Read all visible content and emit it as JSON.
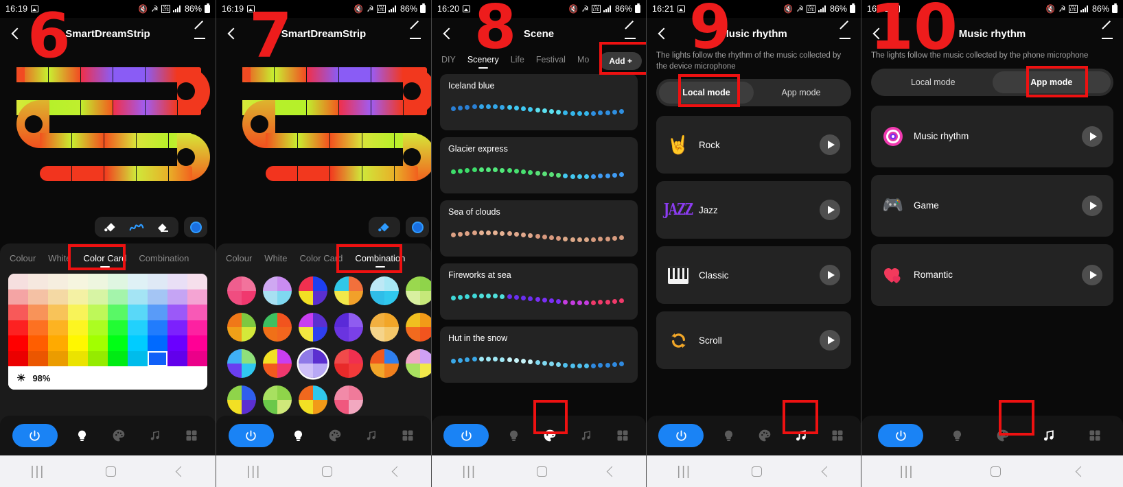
{
  "meta": {
    "app": "SmartDreamStrip LED controller",
    "accent": "#1a83f5",
    "annotation_color": "#ee1111"
  },
  "panels": [
    {
      "step": "6",
      "status": {
        "time": "16:19",
        "battery": "86%",
        "network": "LTE"
      },
      "header": {
        "title": "SmartDreamStrip",
        "back_icon": "chevron-left-icon",
        "edit_icon": "pencil-icon"
      },
      "tools": [
        "paint-bucket-icon",
        "brush-icon",
        "eraser-icon",
        "color-chip-icon"
      ],
      "tabs": [
        {
          "label": "Colour",
          "active": false
        },
        {
          "label": "White",
          "active": false
        },
        {
          "label": "Color Card",
          "active": true
        },
        {
          "label": "Combination",
          "active": false
        }
      ],
      "brightness": "98%",
      "brightness_icon": "sun-icon",
      "selected_swatch": "#1060f8",
      "nav": [
        "power-icon",
        "bulb-icon",
        "palette-icon",
        "music-icon",
        "grid-icon"
      ],
      "nav_active_index": 0,
      "highlight": "Color Card"
    },
    {
      "step": "7",
      "status": {
        "time": "16:19",
        "battery": "86%",
        "network": "LTE"
      },
      "header": {
        "title": "SmartDreamStrip",
        "back_icon": "chevron-left-icon",
        "edit_icon": "pencil-icon"
      },
      "tools": [
        "paint-bucket-icon",
        "color-chip-icon"
      ],
      "tabs": [
        {
          "label": "Colour",
          "active": false
        },
        {
          "label": "White",
          "active": false
        },
        {
          "label": "Color Card",
          "active": false
        },
        {
          "label": "Combination",
          "active": true
        }
      ],
      "nav": [
        "power-icon",
        "bulb-icon",
        "palette-icon",
        "music-icon",
        "grid-icon"
      ],
      "nav_active_index": 0,
      "highlight": "Combination"
    },
    {
      "step": "8",
      "status": {
        "time": "16:20",
        "battery": "86%",
        "network": "LTE"
      },
      "header": {
        "title": "Scene",
        "back_icon": "chevron-left-icon",
        "edit_icon": "pencil-icon"
      },
      "tabs": [
        {
          "label": "DIY",
          "active": false
        },
        {
          "label": "Scenery",
          "active": true
        },
        {
          "label": "Life",
          "active": false
        },
        {
          "label": "Festival",
          "active": false
        },
        {
          "label": "Mo",
          "active": false
        }
      ],
      "add_button": "Add +",
      "scenes": [
        {
          "name": "Iceland blue",
          "colors": [
            "#2a7fd4",
            "#33a6e8",
            "#40c8f2",
            "#5ce0f0",
            "#35b6ea",
            "#2f8fe0"
          ]
        },
        {
          "name": "Glacier express",
          "colors": [
            "#3ddd6a",
            "#52e87a",
            "#48e070",
            "#5ae078",
            "#43c8f0",
            "#3f9cf5"
          ]
        },
        {
          "name": "Sea of clouds",
          "colors": [
            "#dda184",
            "#e6b192",
            "#e0a88c",
            "#d8997e",
            "#dca888",
            "#d79b7e"
          ]
        },
        {
          "name": "Fireworks at sea",
          "colors": [
            "#3fd8d8",
            "#4fe0dc",
            "#6a2ff0",
            "#7a2ff5",
            "#c43ce0",
            "#f03a6a"
          ]
        },
        {
          "name": "Hut in the snow",
          "colors": [
            "#3aa8e8",
            "#9fe8f5",
            "#c6f2f8",
            "#7fd8f0",
            "#4fc0ee",
            "#2f8ae0"
          ]
        }
      ],
      "nav": [
        "power-icon",
        "bulb-icon",
        "palette-icon",
        "music-icon",
        "grid-icon"
      ],
      "nav_active_index": 0,
      "nav_highlight_index": 2,
      "highlight": "Add +"
    },
    {
      "step": "9",
      "status": {
        "time": "16:21",
        "battery": "86%",
        "network": "LTE"
      },
      "header": {
        "title": "Music rhythm",
        "back_icon": "chevron-left-icon",
        "edit_icon": "pencil-icon"
      },
      "subtitle": "The lights follow the rhythm of the music collected by the device microphone",
      "modes": [
        {
          "label": "Local mode",
          "active": true
        },
        {
          "label": "App mode",
          "active": false
        }
      ],
      "items": [
        {
          "label": "Rock",
          "icon": "rock-hand-icon",
          "play": "play-icon"
        },
        {
          "label": "Jazz",
          "icon": "jazz-text-icon",
          "play": "play-icon"
        },
        {
          "label": "Classic",
          "icon": "piano-icon",
          "play": "play-icon"
        },
        {
          "label": "Scroll",
          "icon": "scroll-loop-icon",
          "play": "play-icon"
        }
      ],
      "nav": [
        "power-icon",
        "bulb-icon",
        "palette-icon",
        "music-icon",
        "grid-icon"
      ],
      "nav_active_index": 0,
      "nav_highlight_index": 3,
      "highlight": "Local mode"
    },
    {
      "step": "10",
      "status": {
        "time": "16:21",
        "battery": "86%",
        "network": "LTE"
      },
      "header": {
        "title": "Music rhythm",
        "back_icon": "chevron-left-icon",
        "edit_icon": "pencil-icon"
      },
      "subtitle": "The lights follow the music collected by the phone microphone",
      "modes": [
        {
          "label": "Local mode",
          "active": false
        },
        {
          "label": "App mode",
          "active": true
        }
      ],
      "items": [
        {
          "label": "Music rhythm",
          "icon": "vinyl-disc-icon",
          "play": "play-icon"
        },
        {
          "label": "Game",
          "icon": "gamepad-icon",
          "play": "play-icon"
        },
        {
          "label": "Romantic",
          "icon": "hearts-icon",
          "play": "play-icon"
        }
      ],
      "nav": [
        "power-icon",
        "bulb-icon",
        "palette-icon",
        "music-icon",
        "grid-icon"
      ],
      "nav_active_index": 0,
      "nav_highlight_index": 3,
      "highlight": "App mode"
    }
  ],
  "sysnav": {
    "recents": "|||",
    "home": "home-icon",
    "back": "back-icon"
  }
}
